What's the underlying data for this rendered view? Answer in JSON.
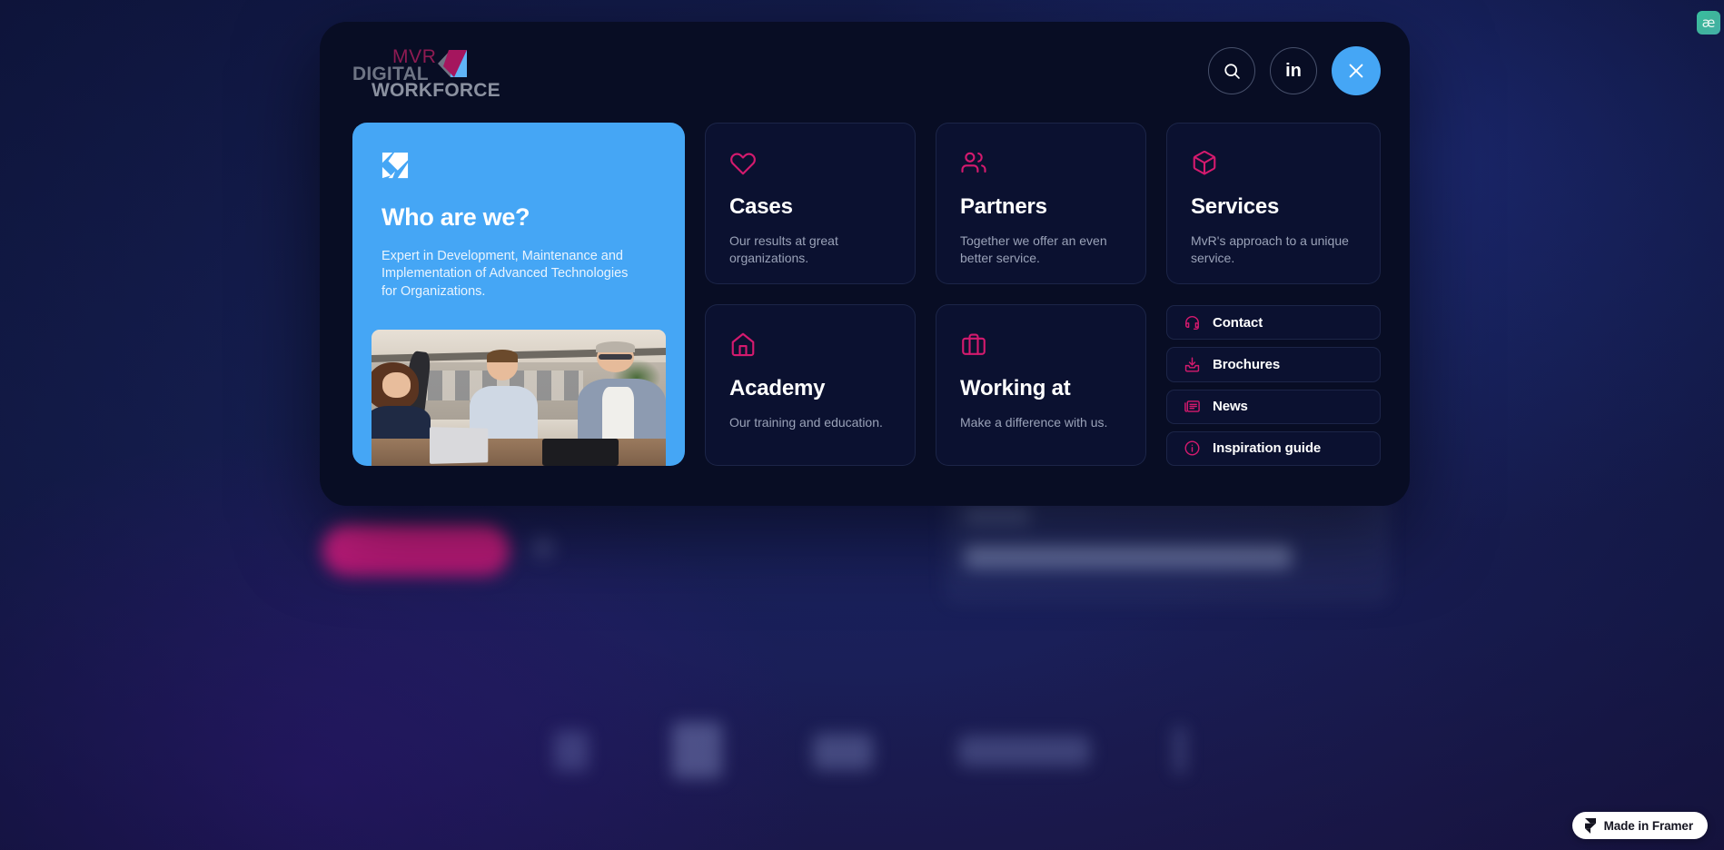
{
  "brand": {
    "logo_line1": "MVR",
    "logo_line2": "DIGITAL",
    "logo_line3": "WORKFORCE",
    "accent_pink": "#d41a6e",
    "accent_blue": "#45a6f5",
    "logo_mvr_color": "#8e1b52",
    "logo_text_color": "#7b8190"
  },
  "header": {
    "search_icon": "search-icon",
    "linkedin_label": "in",
    "close_icon": "close-icon"
  },
  "hero": {
    "icon": "mvr-diamond-icon",
    "title": "Who are we?",
    "description": "Expert in Development, Maintenance and Implementation of Advanced Technologies for Organizations.",
    "photo_alt": "Three colleagues talking at a table with laptops"
  },
  "cards": [
    {
      "icon": "heart-icon",
      "title": "Cases",
      "description": "Our results at great organizations."
    },
    {
      "icon": "users-icon",
      "title": "Partners",
      "description": "Together we offer an even better service."
    },
    {
      "icon": "box-icon",
      "title": "Services",
      "description": "MvR's approach to a unique service."
    },
    {
      "icon": "home-icon",
      "title": "Academy",
      "description": "Our training and education."
    },
    {
      "icon": "briefcase-icon",
      "title": "Working at",
      "description": "Make a difference with us."
    }
  ],
  "links": [
    {
      "icon": "headset-icon",
      "label": "Contact"
    },
    {
      "icon": "download-icon",
      "label": "Brochures"
    },
    {
      "icon": "newspaper-icon",
      "label": "News"
    },
    {
      "icon": "info-icon",
      "label": "Inspiration guide"
    }
  ],
  "footer": {
    "framer_badge": "Made in Framer"
  },
  "browser": {
    "extension_glyph": "æ"
  }
}
